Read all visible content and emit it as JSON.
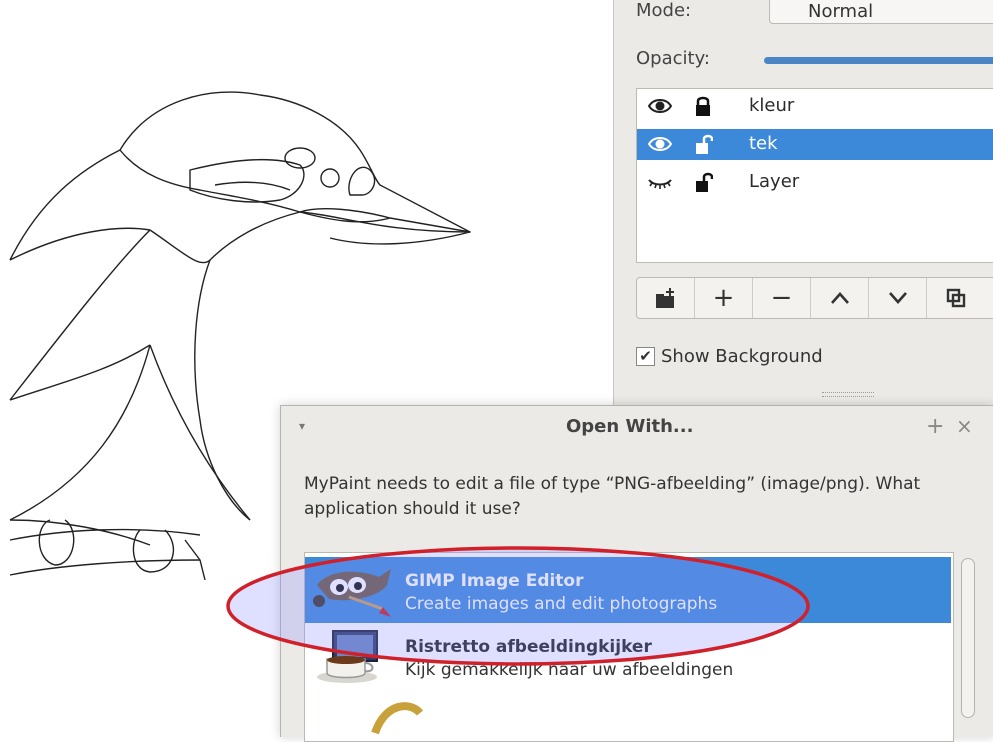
{
  "layers_panel": {
    "mode_label": "Mode:",
    "mode_value": "Normal",
    "opacity_label": "Opacity:",
    "layers": [
      {
        "name": "kleur",
        "visible": true,
        "locked": true,
        "selected": false
      },
      {
        "name": "tek",
        "visible": true,
        "locked": false,
        "selected": true
      },
      {
        "name": "Layer",
        "visible": false,
        "locked": false,
        "selected": false
      }
    ],
    "toolbar_buttons": [
      "add-group-icon",
      "add-layer-icon",
      "remove-layer-icon",
      "move-up-icon",
      "move-down-icon",
      "duplicate-layer-icon"
    ],
    "show_background_label": "Show Background",
    "show_background_checked": true
  },
  "dialog": {
    "title": "Open With...",
    "menu_glyph": "▾",
    "maximize_glyph": "+",
    "close_glyph": "×",
    "message": "MyPaint needs to edit a file of type “PNG-afbeelding” (image/png). What application should it use?",
    "apps": [
      {
        "name": "GIMP Image Editor",
        "description": "Create images and edit photographs",
        "selected": true,
        "icon": "gimp-icon"
      },
      {
        "name": "Ristretto afbeeldingkijker",
        "description": "Kijk gemakkelijk naar uw afbeeldingen",
        "selected": false,
        "icon": "ristretto-icon"
      }
    ]
  },
  "colors": {
    "selection": "#3d89d9",
    "annotation": "#d0202a",
    "panel_bg": "#eceae6"
  }
}
